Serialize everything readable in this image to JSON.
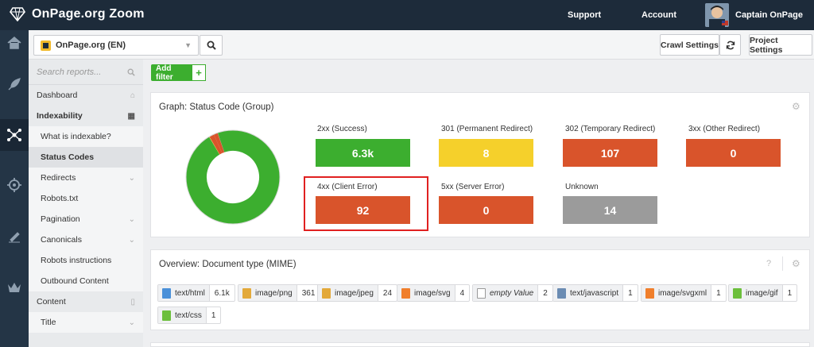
{
  "app": {
    "title": "OnPage.org Zoom"
  },
  "topnav": {
    "support": "Support",
    "account": "Account",
    "user": "Captain OnPage"
  },
  "project": {
    "selected": "OnPage.org (EN)"
  },
  "header_buttons": {
    "crawl_settings": "Crawl Settings",
    "project_settings": "Project Settings"
  },
  "sidebar": {
    "search_placeholder": "Search reports...",
    "items": [
      {
        "label": "Dashboard",
        "type": "section"
      },
      {
        "label": "Indexability",
        "type": "section"
      },
      {
        "label": "What is indexable?",
        "type": "sub"
      },
      {
        "label": "Status Codes",
        "type": "sub-active"
      },
      {
        "label": "Redirects",
        "type": "sub"
      },
      {
        "label": "Robots.txt",
        "type": "sub"
      },
      {
        "label": "Pagination",
        "type": "sub"
      },
      {
        "label": "Canonicals",
        "type": "sub"
      },
      {
        "label": "Robots instructions",
        "type": "sub"
      },
      {
        "label": "Outbound Content",
        "type": "sub"
      },
      {
        "label": "Content",
        "type": "section"
      },
      {
        "label": "Title",
        "type": "sub"
      }
    ]
  },
  "filter": {
    "add_label": "Add filter",
    "plus": "+"
  },
  "status_panel": {
    "title": "Graph: Status Code (Group)",
    "tiles": [
      {
        "label": "2xx (Success)",
        "value": "6.3k",
        "color": "#3cae2f"
      },
      {
        "label": "301 (Permanent Redirect)",
        "value": "8",
        "color": "#f5d02b"
      },
      {
        "label": "302 (Temporary Redirect)",
        "value": "107",
        "color": "#d9542b"
      },
      {
        "label": "3xx (Other Redirect)",
        "value": "0",
        "color": "#d9542b"
      },
      {
        "label": "4xx (Client Error)",
        "value": "92",
        "color": "#d9542b"
      },
      {
        "label": "5xx (Server Error)",
        "value": "0",
        "color": "#d9542b"
      },
      {
        "label": "Unknown",
        "value": "14",
        "color": "#9b9b9b"
      }
    ]
  },
  "chart_data": {
    "type": "pie",
    "categories": [
      "2xx (Success)",
      "301 (Permanent Redirect)",
      "302 (Temporary Redirect)",
      "3xx (Other Redirect)",
      "4xx (Client Error)",
      "5xx (Server Error)",
      "Unknown"
    ],
    "values": [
      6300,
      8,
      107,
      0,
      92,
      0,
      14
    ],
    "colors": [
      "#3cae2f",
      "#f5d02b",
      "#d9542b",
      "#d9542b",
      "#d9542b",
      "#d9542b",
      "#9b9b9b"
    ],
    "donut": true
  },
  "mime_panel": {
    "title": "Overview: Document type (MIME)",
    "help": "?",
    "chips": [
      {
        "label": "text/html",
        "count": "6.1k",
        "icon": "html-file-icon",
        "color": "#4a90d9",
        "italic": false
      },
      {
        "label": "image/png",
        "count": "361",
        "icon": "image-file-icon",
        "color": "#e3a93a",
        "italic": false
      },
      {
        "label": "image/jpeg",
        "count": "24",
        "icon": "image-file-icon",
        "color": "#e3a93a",
        "italic": false
      },
      {
        "label": "image/svg",
        "count": "4",
        "icon": "svg-file-icon",
        "color": "#f07f2c",
        "italic": false
      },
      {
        "label": "empty Value",
        "count": "2",
        "icon": "empty-file-icon",
        "color": "#ffffff",
        "italic": true
      },
      {
        "label": "text/javascript",
        "count": "1",
        "icon": "js-file-icon",
        "color": "#6b8cb3",
        "italic": false
      },
      {
        "label": "image/svgxml",
        "count": "1",
        "icon": "svg-file-icon",
        "color": "#f07f2c",
        "italic": false
      },
      {
        "label": "image/gif",
        "count": "1",
        "icon": "gif-file-icon",
        "color": "#6cbf3c",
        "italic": false
      },
      {
        "label": "text/css",
        "count": "1",
        "icon": "css-file-icon",
        "color": "#6cbf3c",
        "italic": false
      }
    ]
  }
}
